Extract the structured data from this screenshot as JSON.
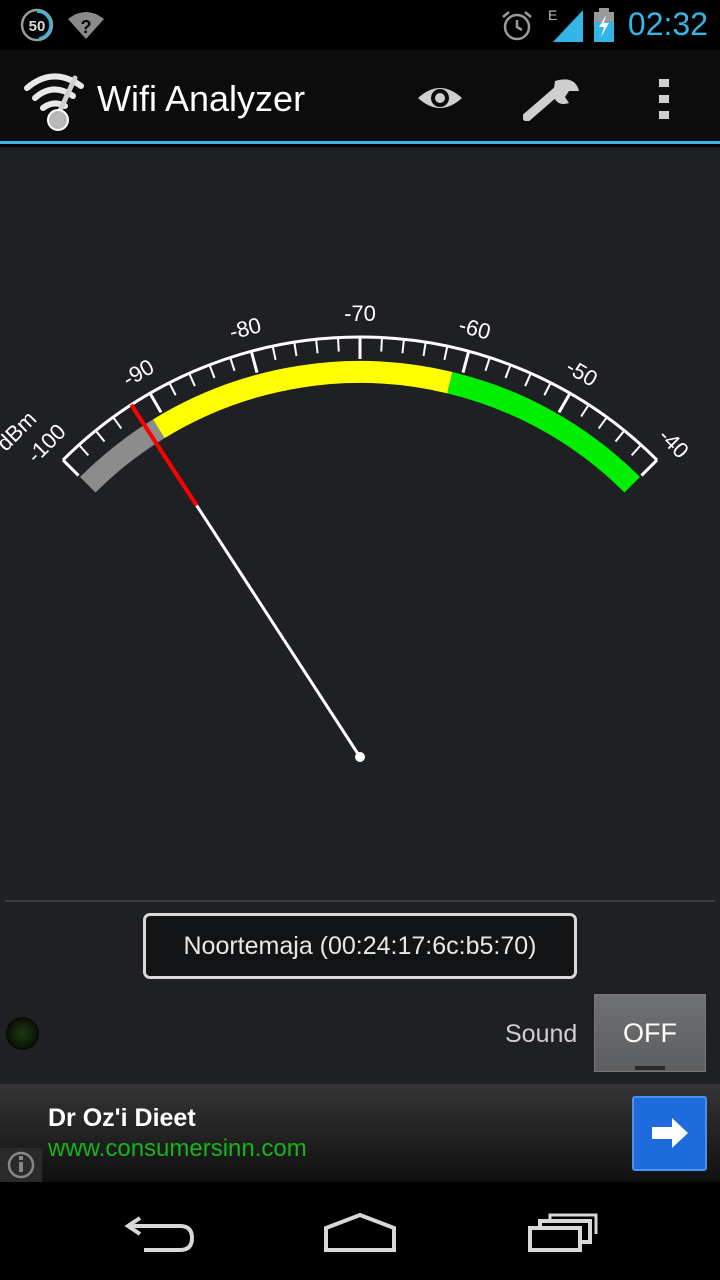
{
  "status_bar": {
    "notification_badge": "50",
    "network_type": "E",
    "time": "02:32"
  },
  "action_bar": {
    "title": "Wifi Analyzer",
    "actions": [
      "eye-icon",
      "wrench-icon",
      "overflow-menu-icon"
    ]
  },
  "gauge": {
    "unit": "dBm",
    "scale_min": -100,
    "scale_max": -40,
    "tick_labels": [
      "-100",
      "-90",
      "-80",
      "-70",
      "-60",
      "-50",
      "-40"
    ],
    "needle_value": -92,
    "zones": [
      {
        "from": -100,
        "to": -91,
        "color": "#8c8c8c"
      },
      {
        "from": -91,
        "to": -61,
        "color": "#ffff00"
      },
      {
        "from": -61,
        "to": -40,
        "color": "#00ee00"
      }
    ]
  },
  "network": {
    "label": "Noortemaja (00:24:17:6c:b5:70)"
  },
  "sound": {
    "label": "Sound",
    "toggle_state": "OFF"
  },
  "ad": {
    "title": "Dr Oz'i Dieet",
    "url": "www.consumersinn.com"
  },
  "colors": {
    "accent": "#33b5e5",
    "background": "#1e2023",
    "needle_tip": "#ff0000",
    "ad_url": "#17b31b",
    "ad_button": "#1e6bde"
  }
}
